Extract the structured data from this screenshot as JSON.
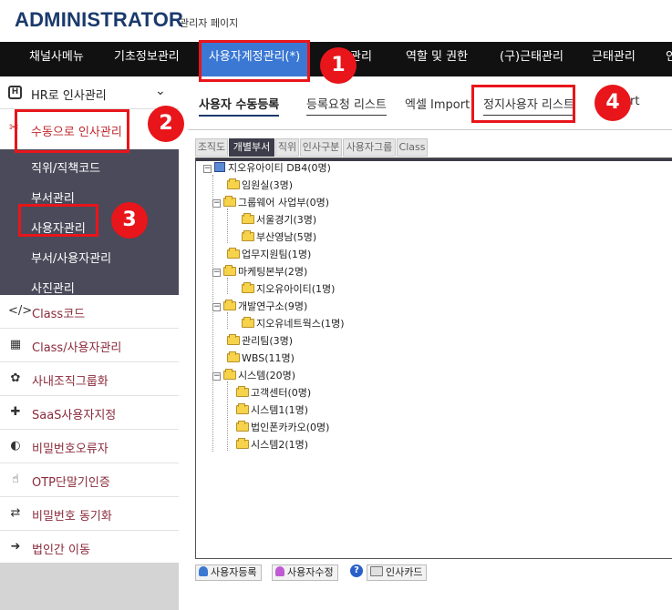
{
  "header": {
    "logo": "ADMINISTRATOR",
    "subtitle": "관리자 페이지"
  },
  "topnav": [
    {
      "label": "채널사메뉴"
    },
    {
      "label": "기초정보관리"
    },
    {
      "label": "사용자계정관리(*)"
    },
    {
      "label": "관리"
    },
    {
      "label": "역할 및 권한"
    },
    {
      "label": "(구)근태관리"
    },
    {
      "label": "근태관리"
    },
    {
      "label": "인"
    }
  ],
  "sidebar": {
    "head": "HR로 인사관리",
    "active": "수동으로 인사관리",
    "submenu": [
      "직위/직책코드",
      "부서관리",
      "사용자관리",
      "부서/사용자관리",
      "사진관리"
    ],
    "items": [
      {
        "label": "Class코드",
        "icon": "code-icon",
        "glyph": "</>"
      },
      {
        "label": "Class/사용자관리",
        "icon": "users-board-icon",
        "glyph": "▦"
      },
      {
        "label": "사내조직그룹화",
        "icon": "group-icon",
        "glyph": "✿"
      },
      {
        "label": "SaaS사용자지정",
        "icon": "puzzle-icon",
        "glyph": "✚"
      },
      {
        "label": "비밀번호오류자",
        "icon": "edge-icon",
        "glyph": "◐"
      },
      {
        "label": "OTP단말기인증",
        "icon": "hand-icon",
        "glyph": "☝"
      },
      {
        "label": "비밀번호 동기화",
        "icon": "sync-icon",
        "glyph": "⇄"
      },
      {
        "label": "법인간 이동",
        "icon": "arrow-circle-icon",
        "glyph": "➜"
      }
    ]
  },
  "tabs": [
    "사용자 수동등록",
    "등록요청 리스트",
    "엑셀 Import",
    "정지사용자 리스트",
    "rt"
  ],
  "pane_tabs": [
    "조직도",
    "개별부서",
    "직위",
    "인사구분",
    "사용자그룹",
    "Class"
  ],
  "tree": [
    {
      "label": "지오유아이티 DB4(0명)"
    },
    {
      "label": "임원실(3명)"
    },
    {
      "label": "그룹웨어 사업부(0명)"
    },
    {
      "label": "서울경기(3명)"
    },
    {
      "label": "부산영남(5명)"
    },
    {
      "label": "업무지원팀(1명)"
    },
    {
      "label": "마케팅본부(2명)"
    },
    {
      "label": "지오유아이티(1명)"
    },
    {
      "label": "개발연구소(9명)"
    },
    {
      "label": "지오유네트웍스(1명)"
    },
    {
      "label": "관리팀(3명)"
    },
    {
      "label": "WBS(11명)"
    },
    {
      "label": "시스템(20명)"
    },
    {
      "label": "고객센터(0명)"
    },
    {
      "label": "시스템1(1명)"
    },
    {
      "label": "법인폰카카오(0명)"
    },
    {
      "label": "시스템2(1명)"
    }
  ],
  "buttons": {
    "register": "사용자등록",
    "edit": "사용자수정",
    "help": "?",
    "card": "인사카드"
  },
  "badges": [
    "1",
    "2",
    "3",
    "4"
  ],
  "colors": {
    "accent": "#3a78d4",
    "nav_bg": "#111111",
    "annotation": "#e8151b",
    "submenu_bg": "#4a4a5a"
  }
}
